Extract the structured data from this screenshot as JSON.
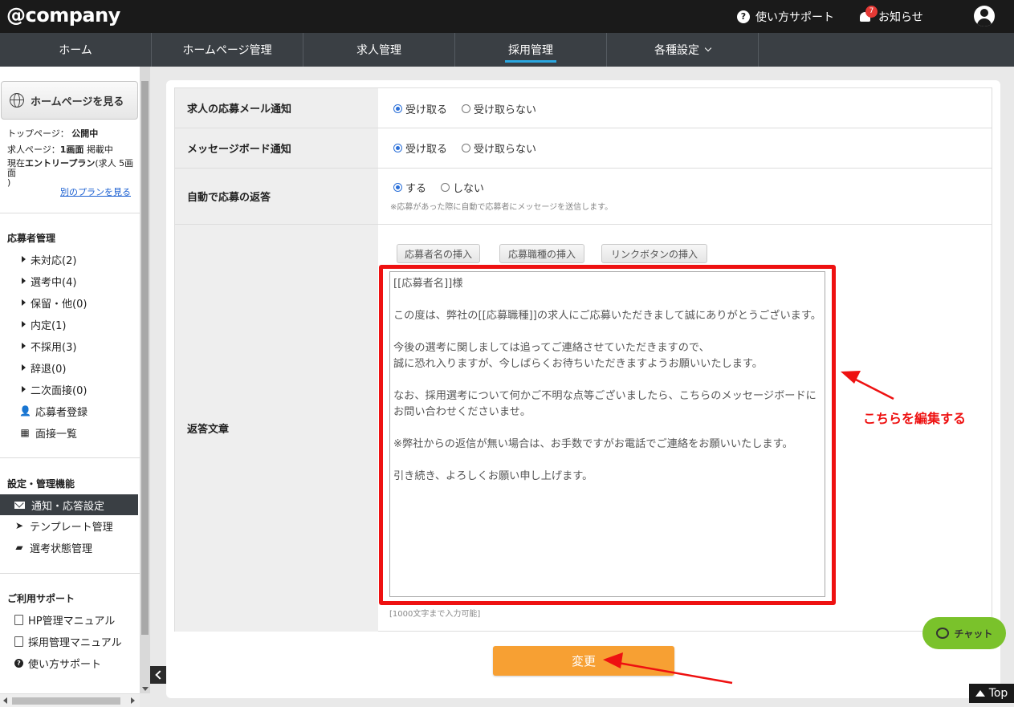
{
  "header": {
    "logo": "@company",
    "help_label": "使い方サポート",
    "notice_label": "お知らせ",
    "notice_count": "7"
  },
  "mainnav": {
    "tabs": [
      {
        "label": "ホーム"
      },
      {
        "label": "ホームページ管理"
      },
      {
        "label": "求人管理"
      },
      {
        "label": "採用管理",
        "active": true
      },
      {
        "label": "各種設定"
      }
    ]
  },
  "sidebar": {
    "view_homepage": "ホームページを見る",
    "top_page_label": "トップページ：",
    "top_page_status": "公開中",
    "job_page_label": "求人ページ：",
    "job_page_status": "1画面",
    "job_page_suffix": "掲載中",
    "plan_label": "現在",
    "plan_name": "エントリープラン",
    "plan_detail": "(求人 5画面",
    "plan_close": ")",
    "other_plan_link": "別のプランを見る",
    "applicant_section": "応募者管理",
    "applicant_items": [
      "未対応(2)",
      "選考中(4)",
      "保留・他(0)",
      "内定(1)",
      "不採用(3)",
      "辞退(0)",
      "二次面接(0)"
    ],
    "register_applicant": "応募者登録",
    "interview_list": "面接一覧",
    "settings_section": "設定・管理機能",
    "notify_settings": "通知・応答設定",
    "template_mgmt": "テンプレート管理",
    "status_mgmt": "選考状態管理",
    "support_section": "ご利用サポート",
    "hp_manual": "HP管理マニュアル",
    "recruit_manual": "採用管理マニュアル",
    "how_to_support": "使い方サポート"
  },
  "form": {
    "mail_notify": {
      "label": "求人の応募メール通知",
      "on": "受け取る",
      "off": "受け取らない"
    },
    "board_notify": {
      "label": "メッセージボード通知",
      "on": "受け取る",
      "off": "受け取らない"
    },
    "auto_reply": {
      "label": "自動で応募の返答",
      "on": "する",
      "off": "しない",
      "note": "※応募があった際に自動で応募者にメッセージを送信します。"
    },
    "reply_text": {
      "label": "返答文章",
      "insert_name": "応募者名の挿入",
      "insert_job": "応募職種の挿入",
      "insert_link": "リンクボタンの挿入",
      "value": "[[応募者名]]様\n\nこの度は、弊社の[[応募職種]]の求人にご応募いただきまして誠にありがとうございます。\n\n今後の選考に関しましては追ってご連絡させていただきますので、\n誠に恐れ入りますが、今しばらくお待ちいただきますようお願いいたします。\n\nなお、採用選考について何かご不明な点等ございましたら、こちらのメッセージボードにお問い合わせくださいませ。\n\n※弊社からの返信が無い場合は、お手数ですがお電話でご連絡をお願いいたします。\n\n引き続き、よろしくお願い申し上げます。",
      "limit_note": "[1000文字まで入力可能]"
    },
    "submit_label": "変更"
  },
  "annotation": "こちらを編集する",
  "chat_label": "チャット",
  "top_label": "Top",
  "colors": {
    "accent_orange": "#f7a033",
    "highlight_red": "#ee1111",
    "chat_green": "#7ac22b",
    "nav_dark": "#3a3f44"
  }
}
